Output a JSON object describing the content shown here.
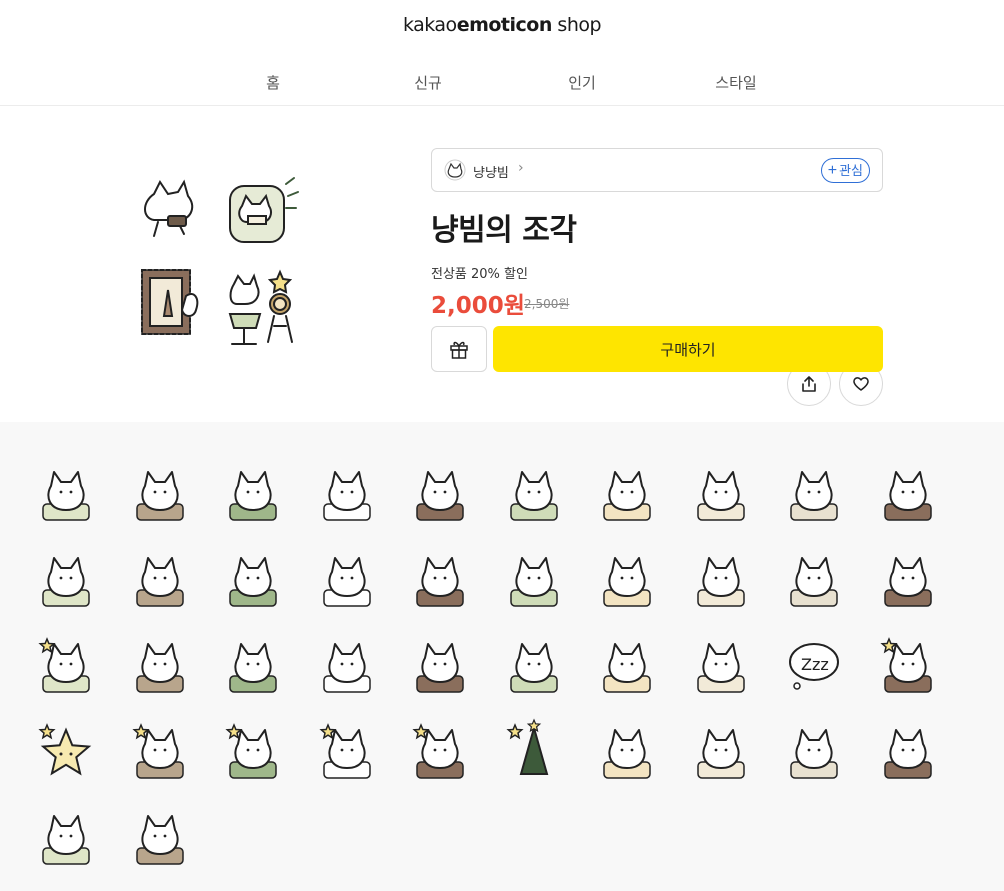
{
  "header": {
    "logo_part1": "kakao",
    "logo_part2": "emoticon",
    "logo_part3": " shop",
    "nav": [
      "홈",
      "신규",
      "인기",
      "스타일"
    ]
  },
  "product": {
    "artist_name": "냥냥빔",
    "follow_label": "관심",
    "title": "냥빔의 조각",
    "discount_text": "전상품 20% 할인",
    "price": "2,000원",
    "original_price": "2,500원",
    "buy_label": "구매하기"
  },
  "colors": {
    "accent_yellow": "#fee500",
    "price_red": "#ea4c3b",
    "follow_blue": "#2f6fd6"
  },
  "emoticons": [
    "cat-armchair",
    "cat-open-book",
    "cat-green-book",
    "cat-walking-bag",
    "cat-lamp-books",
    "cat-lamp-monkey",
    "cat-leaf-hat",
    "cat-calendar",
    "cat-scroll-chart",
    "cat-stamp-frame",
    "cat-fireworks",
    "cat-big-leaf",
    "cat-drinking",
    "cat-popcorn-pair",
    "cat-big-book",
    "cat-knitting",
    "cat-peeking",
    "cat-letter",
    "cat-plant-lying",
    "cat-window",
    "cat-stars-pair",
    "cat-hug",
    "cat-teacup",
    "cat-wave",
    "cat-scissors",
    "cat-bed-reading",
    "cat-bed-pair",
    "cat-green-blob",
    "cat-zzz-bubble",
    "cat-sparkle-thinking",
    "star-face",
    "cat-hug-star",
    "cat-stars-small",
    "cat-cheer-stars",
    "cat-star-juggle",
    "tree-sparkle",
    "cat-lying",
    "cat-cloud-tea",
    "cat-cake-table",
    "cat-round-back",
    "cat-yarn",
    "cat-note-paper"
  ]
}
